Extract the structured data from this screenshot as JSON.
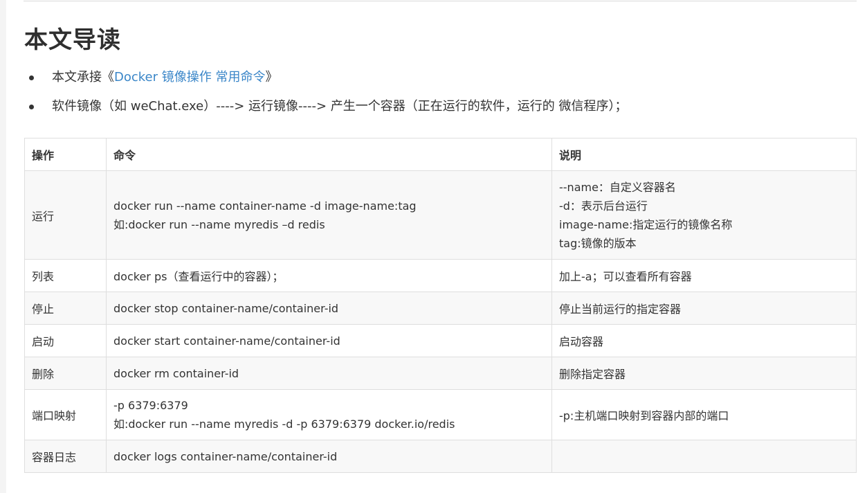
{
  "heading": "本文导读",
  "bullets": [
    {
      "prefix": "本文承接《",
      "link_text": "Docker 镜像操作 常用命令",
      "suffix": "》"
    },
    {
      "text": "软件镜像（如 weChat.exe）----> 运行镜像----> 产生一个容器（正在运行的软件，运行的 微信程序）；"
    }
  ],
  "table": {
    "headers": [
      "操作",
      "命令",
      "说明"
    ],
    "rows": [
      {
        "op": "运行",
        "cmd": [
          "docker run --name container-name -d image-name:tag",
          "如:docker run --name myredis –d redis"
        ],
        "desc": [
          "--name：自定义容器名",
          "-d：表示后台运行",
          "image-name:指定运行的镜像名称",
          "tag:镜像的版本"
        ]
      },
      {
        "op": "列表",
        "cmd": [
          "docker ps（查看运行中的容器）；"
        ],
        "desc": [
          "加上-a；可以查看所有容器"
        ]
      },
      {
        "op": "停止",
        "cmd": [
          "docker stop container-name/container-id"
        ],
        "desc": [
          "停止当前运行的指定容器"
        ]
      },
      {
        "op": "启动",
        "cmd": [
          "docker start container-name/container-id"
        ],
        "desc": [
          "启动容器"
        ]
      },
      {
        "op": "删除",
        "cmd": [
          "docker rm container-id"
        ],
        "desc": [
          "删除指定容器"
        ]
      },
      {
        "op": "端口映射",
        "cmd": [
          "-p 6379:6379",
          "如:docker run  --name myredis  -d -p 6379:6379 docker.io/redis"
        ],
        "desc": [
          "-p:主机端口映射到容器内部的端口"
        ]
      },
      {
        "op": "容器日志",
        "cmd": [
          "docker logs container-name/container-id"
        ],
        "desc": []
      }
    ]
  },
  "colors": {
    "link": "#3a86c8",
    "text": "#333333",
    "border": "#dedede",
    "row_alt": "#f8f8f8"
  }
}
